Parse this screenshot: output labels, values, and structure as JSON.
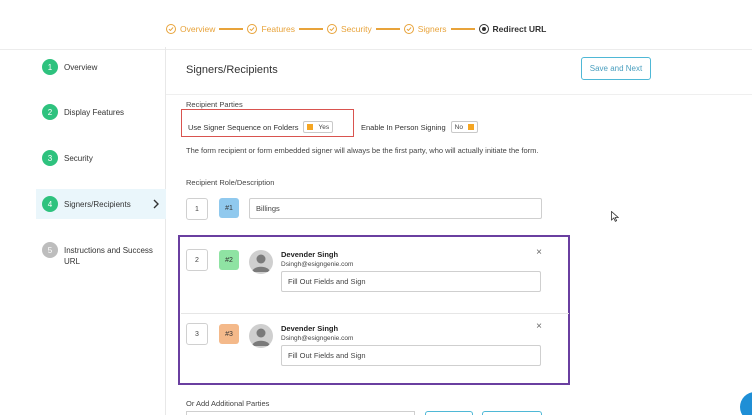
{
  "steps": [
    {
      "label": "Overview",
      "state": "done"
    },
    {
      "label": "Features",
      "state": "done"
    },
    {
      "label": "Security",
      "state": "done"
    },
    {
      "label": "Signers",
      "state": "done"
    },
    {
      "label": "Redirect URL",
      "state": "current"
    }
  ],
  "sidebar": {
    "items": [
      {
        "num": "1",
        "label": "Overview"
      },
      {
        "num": "2",
        "label": "Display Features"
      },
      {
        "num": "3",
        "label": "Security"
      },
      {
        "num": "4",
        "label": "Signers/Recipients"
      },
      {
        "num": "5",
        "label": "Instructions and Success URL"
      }
    ]
  },
  "main": {
    "title": "Signers/Recipients",
    "save_label": "Save and Next",
    "recipient_parties_label": "Recipient Parties",
    "signer_sequence_label": "Use Signer Sequence on Folders",
    "signer_sequence_value": "Yes",
    "in_person_label": "Enable In Person Signing",
    "in_person_value": "No",
    "description": "The form recipient or form embedded signer will always be the first party, who will actually initiate the form.",
    "role_label": "Recipient Role/Description",
    "add_parties_label": "Or Add Additional Parties"
  },
  "recipients": [
    {
      "order": "1",
      "tag": "#1",
      "role": "Billings"
    },
    {
      "order": "2",
      "tag": "#2",
      "name": "Devender Singh",
      "email": "Dsingh@esigngenie.com",
      "role": "Fill Out Fields and Sign"
    },
    {
      "order": "3",
      "tag": "#3",
      "name": "Devender Singh",
      "email": "Dsingh@esigngenie.com",
      "role": "Fill Out Fields and Sign"
    }
  ],
  "colors": {
    "accent": "#e8a33a",
    "step_green": "#2ec27e",
    "highlight_red": "#d9534f",
    "highlight_purple": "#6a3fa0",
    "button_blue": "#4fb8d6"
  }
}
